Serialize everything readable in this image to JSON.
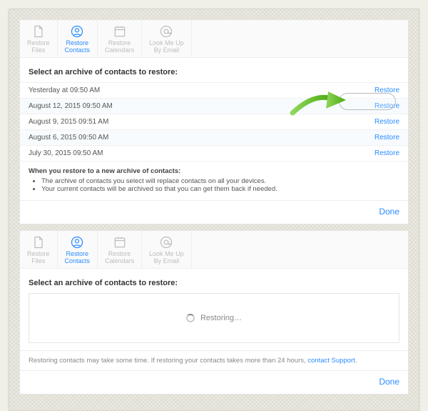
{
  "toolbar": {
    "items": [
      {
        "label": "Restore\nFiles",
        "icon": "file-icon"
      },
      {
        "label": "Restore\nContacts",
        "icon": "contact-icon"
      },
      {
        "label": "Restore\nCalendars",
        "icon": "calendar-icon"
      },
      {
        "label": "Look Me Up\nBy Email",
        "icon": "at-icon"
      }
    ],
    "active_index": 1
  },
  "section_title": "Select an archive of contacts to restore:",
  "archives": [
    {
      "label": "Yesterday at 09:50 AM",
      "action": "Restore"
    },
    {
      "label": "August 12, 2015 09:50 AM",
      "action": "Restore"
    },
    {
      "label": "August 9, 2015 09:51 AM",
      "action": "Restore"
    },
    {
      "label": "August 6, 2015 09:50 AM",
      "action": "Restore"
    },
    {
      "label": "July 30, 2015 09:50 AM",
      "action": "Restore"
    }
  ],
  "info": {
    "heading": "When you restore to a new archive of contacts:",
    "bullets": [
      "The archive of contacts you select will replace contacts on all your devices.",
      "Your current contacts will be archived so that you can get them back if needed."
    ]
  },
  "done_label": "Done",
  "restoring": {
    "status": "Restoring…"
  },
  "note": {
    "text": "Restoring contacts may take some time. If restoring your contacts takes more than 24 hours, ",
    "link": "contact Support",
    "suffix": "."
  },
  "colors": {
    "accent": "#2a8cff"
  }
}
